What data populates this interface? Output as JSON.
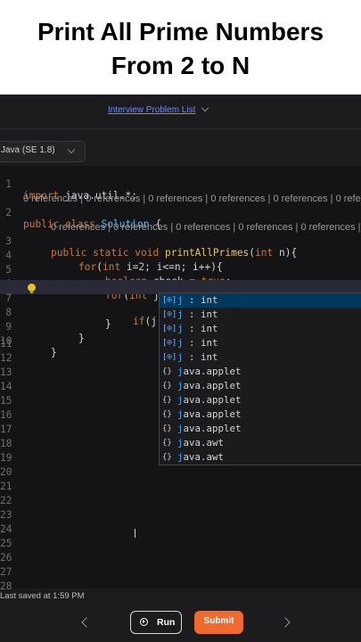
{
  "banner": {
    "line1": "Print All Prime Numbers",
    "line2": "From 2 to N"
  },
  "header": {
    "problem_list_link": "Interview Problem List",
    "dropdown_icon": "chevron-down-icon"
  },
  "language_select": {
    "value": "Java (SE 1.8)",
    "icon": "chevron-down-icon"
  },
  "editor": {
    "line_numbers": [
      "1",
      "2",
      "3",
      "4",
      "5",
      "6",
      "7",
      "8",
      "9",
      "10",
      "11",
      "12",
      "13",
      "14",
      "15",
      "16",
      "17",
      "18",
      "19",
      "20",
      "21",
      "22",
      "23",
      "24",
      "25",
      "26",
      "27",
      "28"
    ],
    "codelens_1": "0 references | 0 references | 0 references | 0 references | 0 references | 0 referen",
    "codelens_2": "0 references | 0 references | 0 references | 0 references | 0 references | 0 re",
    "code_lines": [
      "import java.util.*;",
      "public class Solution {",
      "public static void printAllPrimes(int n){",
      "for(int i=2; i<=n; i++){",
      "boolean check = true;",
      "for(int j=2; j*j<=i; j++){",
      "if(j)",
      "}",
      "}",
      "}"
    ],
    "lightbulb_icon": "lightbulb-icon"
  },
  "suggestions": [
    {
      "icon": "variable-icon",
      "glyph": "[⌾]",
      "match": "j",
      "rest": " : int",
      "selected": true
    },
    {
      "icon": "variable-icon",
      "glyph": "[⌾]",
      "match": "j",
      "rest": " : int",
      "selected": false
    },
    {
      "icon": "variable-icon",
      "glyph": "[⌾]",
      "match": "j",
      "rest": " : int",
      "selected": false
    },
    {
      "icon": "variable-icon",
      "glyph": "[⌾]",
      "match": "j",
      "rest": " : int",
      "selected": false
    },
    {
      "icon": "variable-icon",
      "glyph": "[⌾]",
      "match": "j",
      "rest": " : int",
      "selected": false
    },
    {
      "icon": "module-icon",
      "glyph": "{}",
      "match": "j",
      "rest": "ava.applet",
      "selected": false
    },
    {
      "icon": "module-icon",
      "glyph": "{}",
      "match": "j",
      "rest": "ava.applet",
      "selected": false
    },
    {
      "icon": "module-icon",
      "glyph": "{}",
      "match": "j",
      "rest": "ava.applet",
      "selected": false
    },
    {
      "icon": "module-icon",
      "glyph": "{}",
      "match": "j",
      "rest": "ava.applet",
      "selected": false
    },
    {
      "icon": "module-icon",
      "glyph": "{}",
      "match": "j",
      "rest": "ava.applet",
      "selected": false
    },
    {
      "icon": "module-icon",
      "glyph": "{}",
      "match": "j",
      "rest": "ava.awt",
      "selected": false
    },
    {
      "icon": "module-icon",
      "glyph": "{}",
      "match": "j",
      "rest": "ava.awt",
      "selected": false
    }
  ],
  "status": {
    "last_saved": "Last saved at 1:59 PM"
  },
  "footer": {
    "prev_icon": "chevron-left-icon",
    "run_label": "Run",
    "run_icon": "play-icon",
    "submit_label": "Submit",
    "next_icon": "chevron-right-icon"
  },
  "colors": {
    "background": "#1c1c1e",
    "editor_background": "#141416",
    "accent_link": "#6f86ff",
    "submit": "#f06a2e",
    "keyword": "#cc7832",
    "type": "#4fc1ff",
    "function": "#e8c46a",
    "selection": "#04395e"
  }
}
